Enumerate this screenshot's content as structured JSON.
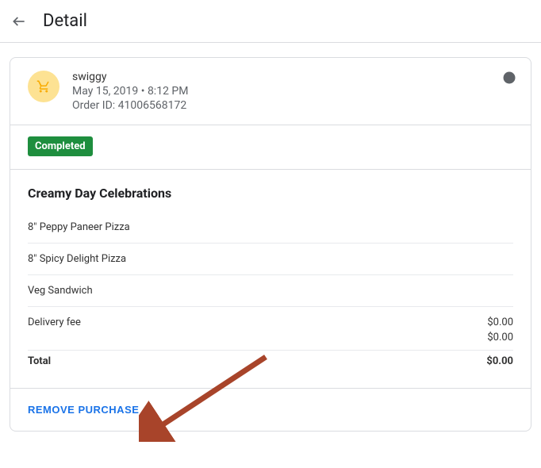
{
  "header": {
    "title": "Detail"
  },
  "merchant": {
    "name": "swiggy",
    "datetime": "May 15, 2019 • 8:12 PM",
    "orderIdLabel": "Order ID: 41006568172"
  },
  "status": {
    "label": "Completed"
  },
  "order": {
    "title": "Creamy Day Celebrations",
    "items": [
      {
        "name": "8\" Peppy Paneer Pizza"
      },
      {
        "name": "8\" Spicy Delight Pizza"
      },
      {
        "name": "Veg Sandwich"
      }
    ],
    "deliveryFeeLabel": "Delivery fee",
    "deliveryFee": "$0.00",
    "subtotal": "$0.00",
    "totalLabel": "Total",
    "total": "$0.00"
  },
  "actions": {
    "removeLabel": "REMOVE PURCHASE"
  }
}
